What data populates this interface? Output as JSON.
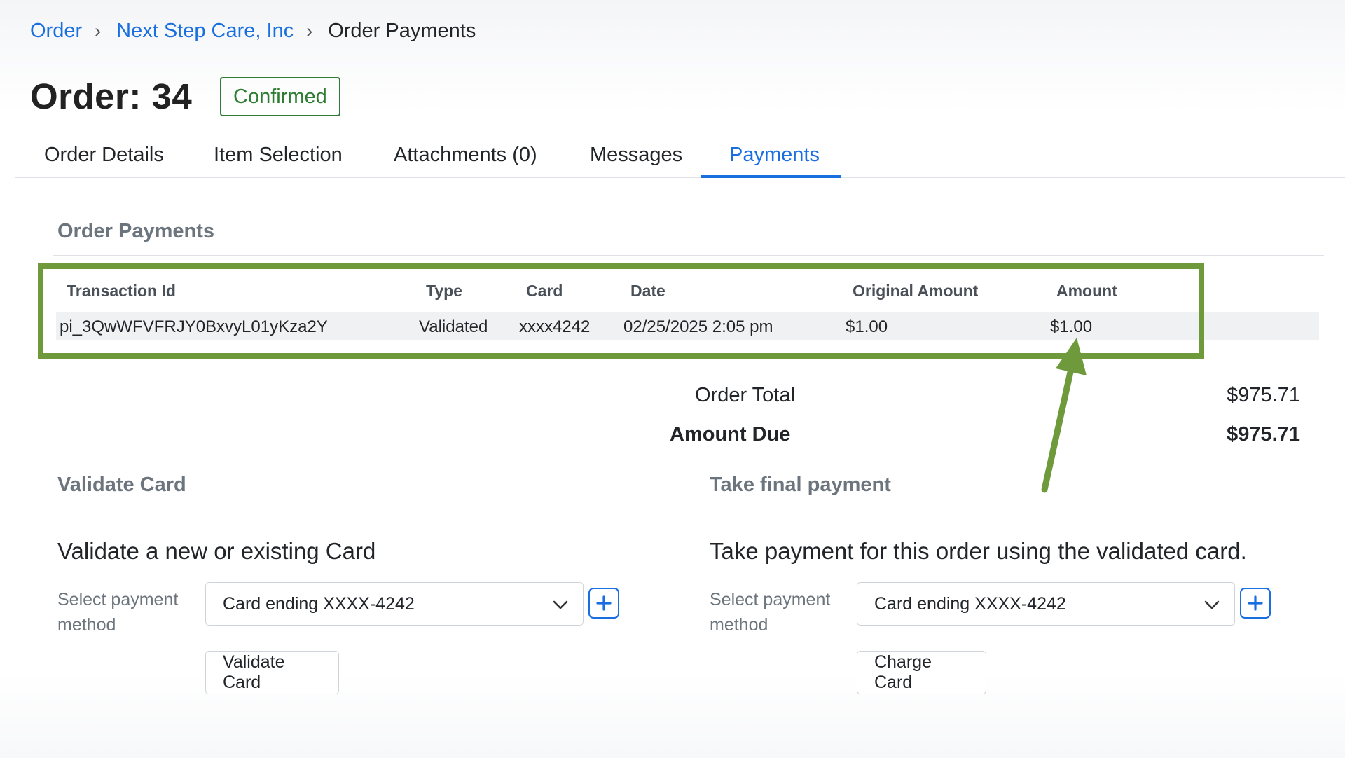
{
  "breadcrumb": {
    "items": [
      "Order",
      "Next Step Care, Inc"
    ],
    "current": "Order Payments"
  },
  "page": {
    "title": "Order: 34",
    "status": "Confirmed",
    "status_color": "#2e7d32"
  },
  "tabs": [
    {
      "label": "Order Details"
    },
    {
      "label": "Item Selection"
    },
    {
      "label": "Attachments (0)"
    },
    {
      "label": "Messages"
    },
    {
      "label": "Payments",
      "active": true
    }
  ],
  "payments": {
    "heading": "Order Payments",
    "columns": [
      "Transaction Id",
      "Type",
      "Card",
      "Date",
      "Original Amount",
      "Amount"
    ],
    "rows": [
      [
        "pi_3QwWFVFRJY0BxvyL01yKza2Y",
        "Validated",
        "xxxx4242",
        "02/25/2025 2:05 pm",
        "$1.00",
        "$1.00"
      ]
    ]
  },
  "totals": {
    "order_total_label": "Order Total",
    "order_total_value": "$975.71",
    "amount_due_label": "Amount Due",
    "amount_due_value": "$975.71"
  },
  "validate": {
    "heading": "Validate Card",
    "subheading": "Validate a new or existing Card",
    "label": "Select payment method",
    "selected": "Card ending XXXX-4242",
    "button": "Validate Card"
  },
  "final": {
    "heading": "Take final payment",
    "subheading": "Take payment for this order using the validated card.",
    "label": "Select payment method",
    "selected": "Card ending XXXX-4242",
    "button": "Charge Card"
  },
  "colors": {
    "accent": "#1a6fe0",
    "annotation": "#6e9a3c"
  },
  "icons": [
    "chevron-right-icon",
    "chevron-down-icon",
    "plus-icon",
    "arrow-annotation"
  ]
}
